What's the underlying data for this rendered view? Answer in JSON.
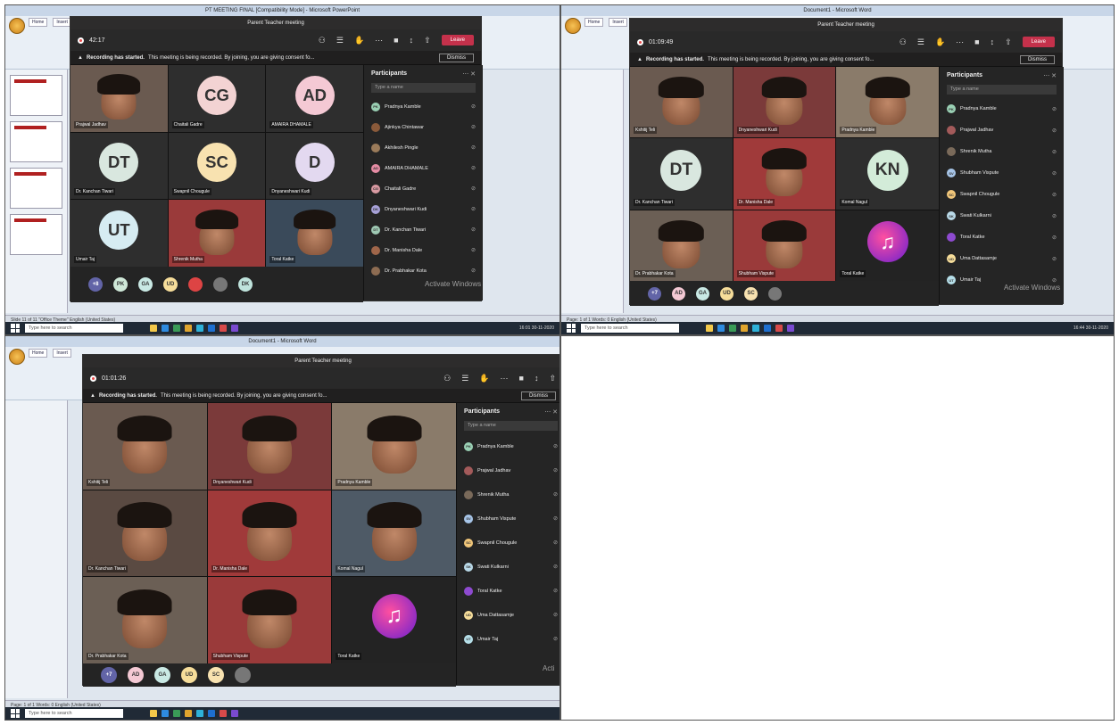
{
  "shot1": {
    "office_title": "PT MEETING FINAL [Compatibility Mode] - Microsoft PowerPoint",
    "ribbon_tabs": [
      "Home",
      "Insert"
    ],
    "statusbar": "Slide 11 of 11   \"Office Theme\"   English (United States)",
    "teams_title": "Parent Teacher meeting",
    "timer": "42:17",
    "leave": "Leave",
    "banner_bold": "Recording has started.",
    "banner_text": "This meeting is being recorded. By joining, you are giving consent fo...",
    "dismiss": "Dismiss",
    "participants_title": "Participants",
    "search_placeholder": "Type a name",
    "tiles": [
      {
        "name": "Prajwal Jadhav",
        "type": "photo",
        "initials": ""
      },
      {
        "name": "Chaitali Gadre",
        "type": "avatar",
        "initials": "CG",
        "color": "#f3d3d3"
      },
      {
        "name": "AMAIRA DHAMALE",
        "type": "avatar",
        "initials": "AD",
        "color": "#f4c9d4"
      },
      {
        "name": "Dr. Kanchan Tiwari",
        "type": "avatar",
        "initials": "DT",
        "color": "#d9e7df"
      },
      {
        "name": "Swapnil Chougule",
        "type": "avatar",
        "initials": "SC",
        "color": "#f8e2b0"
      },
      {
        "name": "Dnyaneshwari Kudi",
        "type": "avatar",
        "initials": "D",
        "color": "#e3d9f0"
      },
      {
        "name": "Umair Taj",
        "type": "avatar",
        "initials": "UT",
        "color": "#d6ecf2"
      },
      {
        "name": "Shrenik Mutha",
        "type": "photo",
        "initials": ""
      },
      {
        "name": "Toral Katke",
        "type": "photo",
        "initials": ""
      }
    ],
    "strip": [
      {
        "label": "+8",
        "color": "#6264a7"
      },
      {
        "label": "PK",
        "color": "#cfe8d8"
      },
      {
        "label": "GA",
        "color": "#c9e9e4"
      },
      {
        "label": "UD",
        "color": "#f6dd9a"
      },
      {
        "label": "",
        "color": "#d44"
      },
      {
        "label": "",
        "color": "#777"
      },
      {
        "label": "DK",
        "color": "#bfe3dc"
      }
    ],
    "participants": [
      {
        "name": "Pradnya Kamble",
        "initials": "PK",
        "color": "#9ad0b4"
      },
      {
        "name": "Ajinkya Chintawar",
        "initials": "",
        "color": "#8a5a3a"
      },
      {
        "name": "Akhilesh Pingle",
        "initials": "",
        "color": "#9b7b5a"
      },
      {
        "name": "AMAIRA DHAMALE",
        "initials": "AD",
        "color": "#e58ca4"
      },
      {
        "name": "Chaitali Gadre",
        "initials": "CG",
        "color": "#d99aa2"
      },
      {
        "name": "Dnyaneshwari Kudi",
        "initials": "DK",
        "color": "#a7a1d8"
      },
      {
        "name": "Dr. Kanchan Tiwari",
        "initials": "DT",
        "color": "#9fc9b4",
        "sub": "Organizer"
      },
      {
        "name": "Dr. Manisha Dale",
        "initials": "",
        "color": "#a0664a"
      },
      {
        "name": "Dr. Prabhakar Kota",
        "initials": "",
        "color": "#8d6c52"
      }
    ],
    "activate": "Activate Windows",
    "clock": "16:01 30-11-2020",
    "search": "Type here to search"
  },
  "shot2": {
    "office_title": "Document1 - Microsoft Word",
    "ribbon_tabs": [
      "Home",
      "Insert"
    ],
    "statusbar": "Page: 1 of 1   Words: 0   English (United States)",
    "teams_title": "Parent Teacher meeting",
    "timer": "01:09:49",
    "leave": "Leave",
    "banner_bold": "Recording has started.",
    "banner_text": "This meeting is being recorded. By joining, you are giving consent fo...",
    "dismiss": "Dismiss",
    "participants_title": "Participants",
    "search_placeholder": "Type a name",
    "tiles": [
      {
        "name": "Kshitij Teli",
        "type": "photo",
        "initials": ""
      },
      {
        "name": "Dnyaneshwari Kudi",
        "type": "photo",
        "initials": ""
      },
      {
        "name": "Pradnya Kamble",
        "type": "photo",
        "initials": ""
      },
      {
        "name": "Dr. Kanchan Tiwari",
        "type": "avatar",
        "initials": "DT",
        "color": "#d9e7df"
      },
      {
        "name": "Dr. Manisha Dale",
        "type": "photo",
        "initials": ""
      },
      {
        "name": "Komal Nagul",
        "type": "avatar",
        "initials": "KN",
        "color": "#d3ecd9"
      },
      {
        "name": "Dr. Prabhakar Kota",
        "type": "photo",
        "initials": ""
      },
      {
        "name": "Shubham Vispute",
        "type": "photo",
        "initials": ""
      },
      {
        "name": "Toral Katke",
        "type": "music",
        "initials": ""
      }
    ],
    "strip": [
      {
        "label": "+7",
        "color": "#6264a7"
      },
      {
        "label": "AD",
        "color": "#f4c9d4"
      },
      {
        "label": "GA",
        "color": "#c9e9e4"
      },
      {
        "label": "UD",
        "color": "#f6dd9a"
      },
      {
        "label": "SC",
        "color": "#f8e2b0"
      },
      {
        "label": "",
        "color": "#777"
      }
    ],
    "participants": [
      {
        "name": "Pradnya Kamble",
        "initials": "PK",
        "color": "#9ad0b4"
      },
      {
        "name": "Prajwal Jadhav",
        "initials": "",
        "color": "#a35a5a"
      },
      {
        "name": "Shrenik Mutha",
        "initials": "",
        "color": "#7a6a5a"
      },
      {
        "name": "Shubham Vispute",
        "initials": "SV",
        "color": "#a7c5e8"
      },
      {
        "name": "Swapnil Chougule",
        "initials": "SC",
        "color": "#f2c77a"
      },
      {
        "name": "Swati Kulkarni",
        "initials": "SK",
        "color": "#b9d9e8"
      },
      {
        "name": "Toral Katke",
        "initials": "",
        "color": "#8e4ad0"
      },
      {
        "name": "Uma Dattasamje",
        "initials": "UD",
        "color": "#f6dd9a"
      },
      {
        "name": "Umair Taj",
        "initials": "UT",
        "color": "#b6dfe9"
      }
    ],
    "activate": "Activate Windows",
    "clock": "16:44 30-11-2020",
    "search": "Type here to search"
  },
  "shot3": {
    "office_title": "Document1 - Microsoft Word",
    "ribbon_tabs": [
      "Home",
      "Insert"
    ],
    "statusbar": "Page: 1 of 1   Words: 0   English (United States)",
    "teams_title": "Parent Teacher meeting",
    "timer": "01:01:26",
    "banner_bold": "Recording has started.",
    "banner_text": "This meeting is being recorded. By joining, you are giving consent fo...",
    "dismiss": "Dismiss",
    "participants_title": "Participants",
    "search_placeholder": "Type a name",
    "tiles": [
      {
        "name": "Kshitij Teli",
        "type": "photo",
        "initials": ""
      },
      {
        "name": "Dnyaneshwari Kudi",
        "type": "photo",
        "initials": ""
      },
      {
        "name": "Pradnya Kamble",
        "type": "photo",
        "initials": ""
      },
      {
        "name": "Dr. Kanchan Tiwari",
        "type": "photo",
        "initials": ""
      },
      {
        "name": "Dr. Manisha Dale",
        "type": "photo",
        "initials": ""
      },
      {
        "name": "Komal Nagul",
        "type": "photo",
        "initials": ""
      },
      {
        "name": "Dr. Prabhakar Kota",
        "type": "photo",
        "initials": ""
      },
      {
        "name": "Shubham Vispute",
        "type": "photo",
        "initials": ""
      },
      {
        "name": "Toral Katke",
        "type": "music",
        "initials": ""
      }
    ],
    "strip": [
      {
        "label": "+7",
        "color": "#6264a7"
      },
      {
        "label": "AD",
        "color": "#f4c9d4"
      },
      {
        "label": "GA",
        "color": "#c9e9e4"
      },
      {
        "label": "UD",
        "color": "#f6dd9a"
      },
      {
        "label": "SC",
        "color": "#f8e2b0"
      },
      {
        "label": "",
        "color": "#777"
      }
    ],
    "participants": [
      {
        "name": "Pradnya Kamble",
        "initials": "PK",
        "color": "#9ad0b4"
      },
      {
        "name": "Prajwal Jadhav",
        "initials": "",
        "color": "#a35a5a"
      },
      {
        "name": "Shrenik Mutha",
        "initials": "",
        "color": "#7a6a5a"
      },
      {
        "name": "Shubham Vispute",
        "initials": "SV",
        "color": "#a7c5e8"
      },
      {
        "name": "Swapnil Chougule",
        "initials": "SC",
        "color": "#f2c77a"
      },
      {
        "name": "Swati Kulkarni",
        "initials": "SK",
        "color": "#b9d9e8"
      },
      {
        "name": "Toral Katke",
        "initials": "",
        "color": "#8e4ad0"
      },
      {
        "name": "Uma Dattasamje",
        "initials": "UD",
        "color": "#f6dd9a"
      },
      {
        "name": "Umair Taj",
        "initials": "UT",
        "color": "#b6dfe9"
      }
    ],
    "activate": "Acti",
    "search": "Type here to search"
  }
}
